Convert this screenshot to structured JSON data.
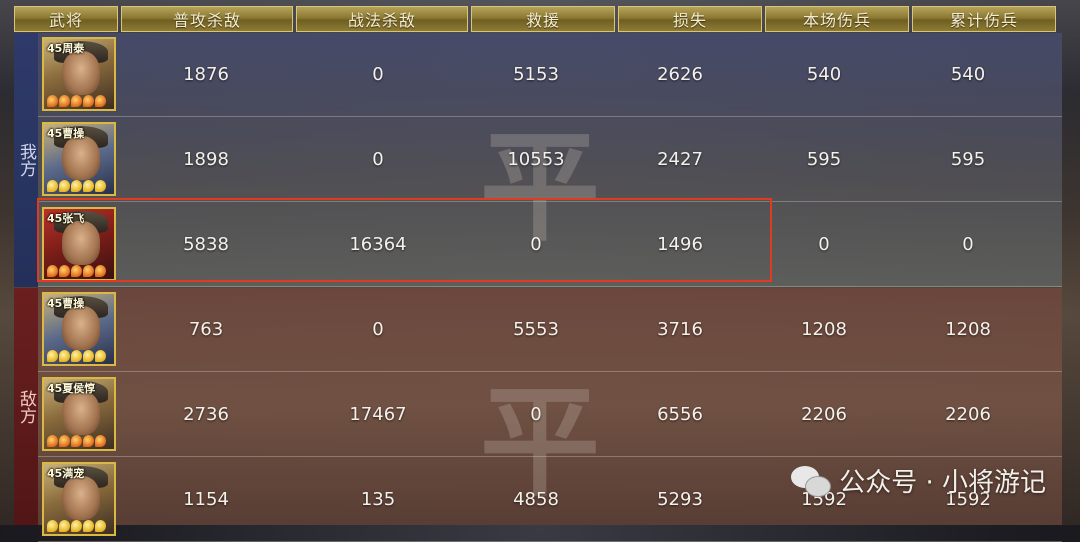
{
  "header": {
    "columns": [
      "武将",
      "普攻杀敌",
      "战法杀敌",
      "救援",
      "损失",
      "本场伤兵",
      "累计伤兵"
    ]
  },
  "sides": {
    "ours_label": "我方",
    "enemy_label": "敌方"
  },
  "watermark": {
    "ours": "平",
    "enemy": "平"
  },
  "ours_rows": [
    {
      "level_name": "45周泰",
      "pips": 5,
      "pip_color": "orange",
      "normal_kills": "1876",
      "tactic_kills": "0",
      "rescue": "5153",
      "loss": "2626",
      "wounded_this": "540",
      "wounded_total": "540"
    },
    {
      "level_name": "45曹操",
      "pips": 5,
      "pip_color": "yellow",
      "normal_kills": "1898",
      "tactic_kills": "0",
      "rescue": "10553",
      "loss": "2427",
      "wounded_this": "595",
      "wounded_total": "595"
    },
    {
      "level_name": "45张飞",
      "pips": 5,
      "pip_color": "orange",
      "normal_kills": "5838",
      "tactic_kills": "16364",
      "rescue": "0",
      "loss": "1496",
      "wounded_this": "0",
      "wounded_total": "0"
    }
  ],
  "enemy_rows": [
    {
      "level_name": "45曹操",
      "pips": 5,
      "pip_color": "yellow",
      "normal_kills": "763",
      "tactic_kills": "0",
      "rescue": "5553",
      "loss": "3716",
      "wounded_this": "1208",
      "wounded_total": "1208"
    },
    {
      "level_name": "45夏侯惇",
      "pips": 5,
      "pip_color": "orange",
      "normal_kills": "2736",
      "tactic_kills": "17467",
      "rescue": "0",
      "loss": "6556",
      "wounded_this": "2206",
      "wounded_total": "2206"
    },
    {
      "level_name": "45满宠",
      "pips": 5,
      "pip_color": "yellow",
      "normal_kills": "1154",
      "tactic_kills": "135",
      "rescue": "4858",
      "loss": "5293",
      "wounded_this": "1592",
      "wounded_total": "1592"
    }
  ],
  "footer": {
    "text": "公众号 · 小将游记",
    "icon": "wechat-icon"
  },
  "colors": {
    "highlight": "#e03a20",
    "header_gold": "#8b7932"
  }
}
